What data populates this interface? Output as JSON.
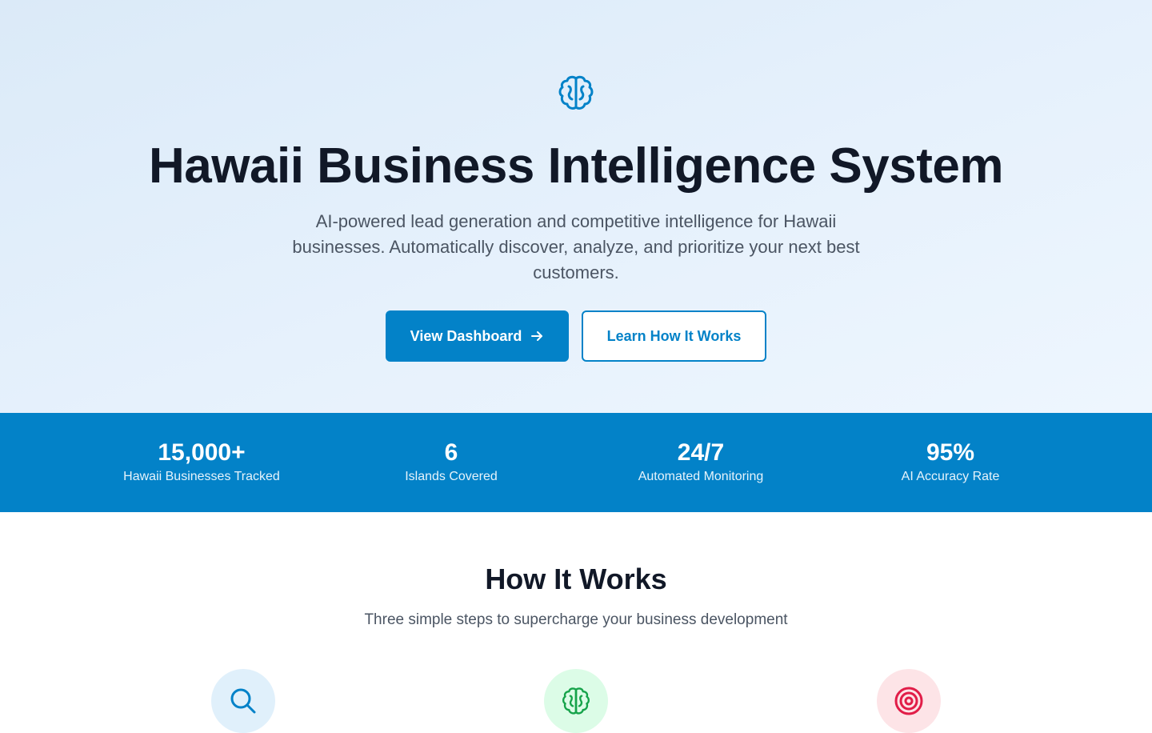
{
  "hero": {
    "icon": "brain-icon",
    "title": "Hawaii Business Intelligence System",
    "subtitle": "AI-powered lead generation and competitive intelligence for Hawaii businesses. Automatically discover, analyze, and prioritize your next best customers.",
    "primary_button": "View Dashboard",
    "secondary_button": "Learn How It Works"
  },
  "stats": [
    {
      "value": "15,000+",
      "label": "Hawaii Businesses Tracked"
    },
    {
      "value": "6",
      "label": "Islands Covered"
    },
    {
      "value": "24/7",
      "label": "Automated Monitoring"
    },
    {
      "value": "95%",
      "label": "AI Accuracy Rate"
    }
  ],
  "how_it_works": {
    "title": "How It Works",
    "subtitle": "Three simple steps to supercharge your business development",
    "steps": [
      {
        "icon": "search-icon",
        "color": "#0382c8",
        "bg": "#e0f0fb"
      },
      {
        "icon": "brain-icon",
        "color": "#16a34a",
        "bg": "#dcfce7"
      },
      {
        "icon": "target-icon",
        "color": "#e11d48",
        "bg": "#fde4e7"
      }
    ]
  },
  "colors": {
    "accent": "#0382c8",
    "heading": "#111827",
    "body_text": "#4b5563"
  }
}
